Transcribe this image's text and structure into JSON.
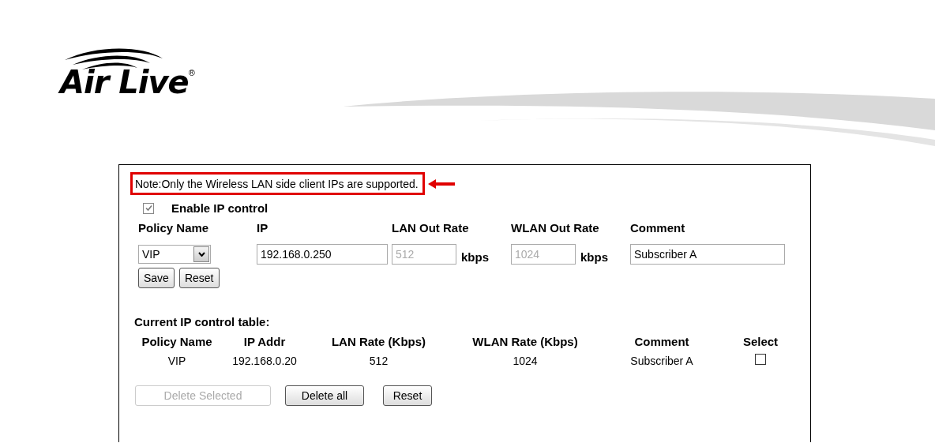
{
  "logo": {
    "text": "Air Live",
    "mark": "®"
  },
  "note": "Note:Only the Wireless LAN side client IPs are supported.",
  "enable": {
    "label": "Enable IP control",
    "checked": true
  },
  "form": {
    "columns": [
      "Policy Name",
      "IP",
      "LAN Out Rate",
      "WLAN Out Rate",
      "Comment"
    ],
    "policy": {
      "value": "VIP"
    },
    "ip": {
      "value": "192.168.0.250",
      "disabled": false
    },
    "lan_rate": {
      "value": "512",
      "disabled": true,
      "unit": "kbps"
    },
    "wlan_rate": {
      "value": "1024",
      "disabled": true,
      "unit": "kbps"
    },
    "comment": {
      "value": "Subscriber A",
      "disabled": false
    },
    "buttons": [
      {
        "label": "Save",
        "disabled": false
      },
      {
        "label": "Reset",
        "disabled": false
      }
    ]
  },
  "table": {
    "title": "Current IP control table:",
    "columns": [
      "Policy Name",
      "IP Addr",
      "LAN Rate (Kbps)",
      "WLAN Rate (Kbps)",
      "Comment",
      "Select"
    ],
    "rows": [
      {
        "cells": [
          "VIP",
          "192.168.0.20",
          "512",
          "1024",
          "Subscriber A"
        ],
        "checked": false
      }
    ]
  },
  "buttons": [
    {
      "label": "Delete Selected",
      "disabled": true
    },
    {
      "label": "Delete all",
      "disabled": false
    },
    {
      "label": "Reset",
      "disabled": false
    }
  ]
}
